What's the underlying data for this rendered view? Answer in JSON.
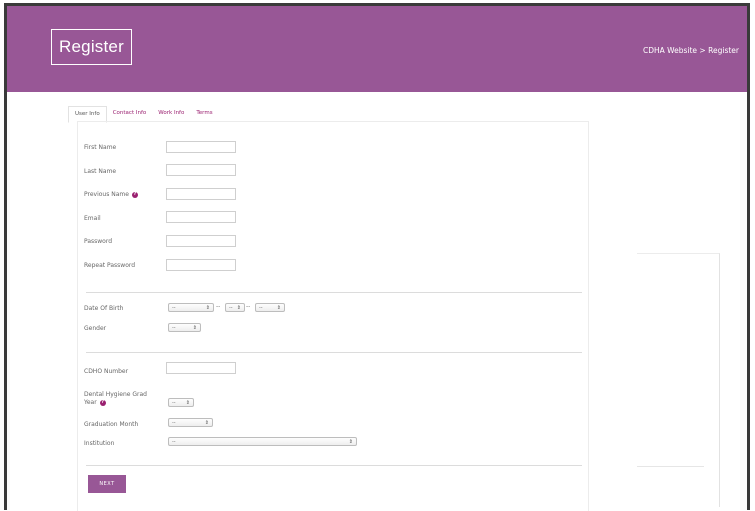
{
  "header": {
    "title": "Register",
    "breadcrumb_link": "CDHA Website",
    "breadcrumb_sep": " > ",
    "breadcrumb_current": "Register"
  },
  "tabs": [
    {
      "label": "User Info"
    },
    {
      "label": "Contact Info"
    },
    {
      "label": "Work Info"
    },
    {
      "label": "Terms"
    }
  ],
  "form": {
    "first_name": {
      "label": "First Name",
      "value": ""
    },
    "last_name": {
      "label": "Last Name",
      "value": ""
    },
    "previous_name": {
      "label": "Previous Name",
      "value": ""
    },
    "email": {
      "label": "Email",
      "value": ""
    },
    "password": {
      "label": "Password",
      "value": ""
    },
    "repeat_password": {
      "label": "Repeat Password",
      "value": ""
    },
    "dob": {
      "label": "Date Of Birth",
      "month": "--",
      "day": "--",
      "year": "--",
      "sep": "--"
    },
    "gender": {
      "label": "Gender",
      "value": "--"
    },
    "cdho_number": {
      "label": "CDHO Number",
      "value": ""
    },
    "grad_year": {
      "label_line1": "Dental Hygiene Grad",
      "label_line2": "Year",
      "value": "--"
    },
    "grad_month": {
      "label": "Graduation Month",
      "value": "--"
    },
    "institution": {
      "label": "Institution",
      "value": "--"
    }
  },
  "buttons": {
    "next": "NEXT"
  },
  "colors": {
    "brand": "#985796",
    "link": "#9a2070"
  }
}
